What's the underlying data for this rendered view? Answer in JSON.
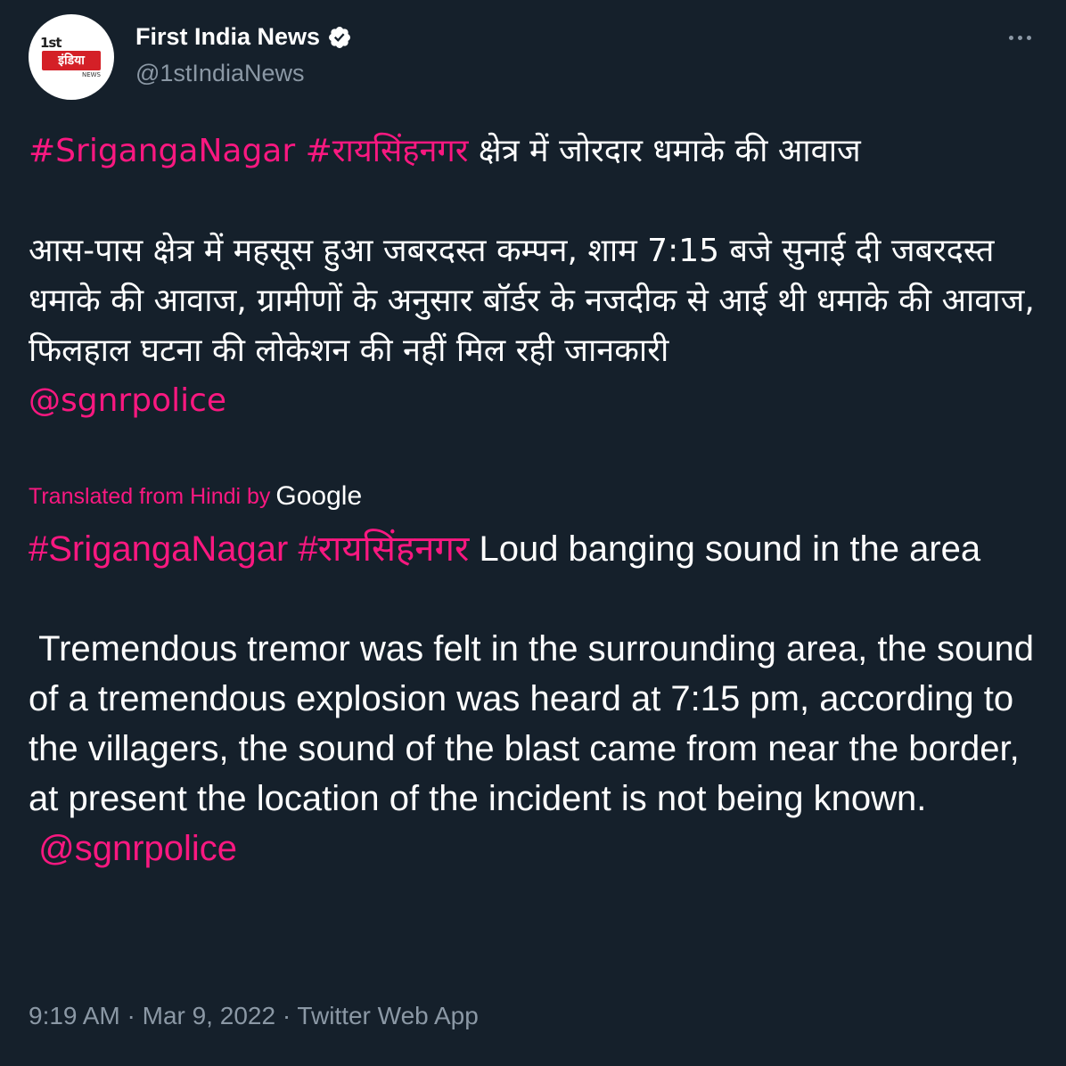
{
  "author": {
    "display_name": "First India News",
    "handle": "@1stIndiaNews",
    "avatar_text_top": "1st",
    "avatar_text_band": "इंडिया",
    "avatar_text_sub": "NEWS",
    "verified_icon": "verified-badge"
  },
  "more_icon": "more-horizontal",
  "tweet": {
    "line1_tag1": "#SrigangaNagar",
    "line1_tag2": "#रायसिंहनगर",
    "line1_text": "क्षेत्र में जोरदार धमाके की आवाज",
    "para2": "आस-पास क्षेत्र में महसूस हुआ जबरदस्त कम्पन, शाम 7:15 बजे सुनाई दी जबरदस्त धमाके की आवाज, ग्रामीणों के अनुसार बॉर्डर के नजदीक से आई थी धमाके की आवाज, फिलहाल घटना की लोकेशन की नहीं मिल रही जानकारी",
    "mention": "@sgnrpolice"
  },
  "translation_note": {
    "label": "Translated from Hindi by",
    "provider": "Google"
  },
  "translation": {
    "line1_tag1": "#SrigangaNagar",
    "line1_tag2": "#रायसिंहनगर",
    "line1_text": "Loud banging sound in the area",
    "para2": "Tremendous tremor was felt in the surrounding area, the sound of a tremendous explosion was heard at 7:15 pm, according to the villagers, the sound of the blast came from near the border, at present the location of the incident is not being known.",
    "mention": "@sgnrpolice"
  },
  "footer": {
    "meta": "9:19 AM · Mar 9, 2022 · Twitter Web App"
  },
  "colors": {
    "background": "#15202b",
    "link": "#f91880",
    "secondary": "#8b98a5",
    "verified": "#ffffff"
  }
}
